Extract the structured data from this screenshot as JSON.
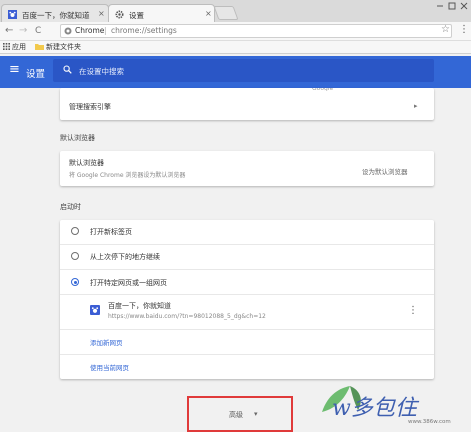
{
  "tabs": [
    {
      "title": "百度一下，你就知道",
      "close": "×"
    },
    {
      "title": "设置",
      "close": "×"
    }
  ],
  "toolbar": {
    "back": "←",
    "forward": "→",
    "reload": "C",
    "site_name": "Chrome",
    "separator": "|",
    "url": "chrome://settings",
    "star": "☆",
    "menu": "⋮"
  },
  "bookmarks": {
    "apps_label": "应用",
    "folder_label": "新建文件夹"
  },
  "header": {
    "menu_icon": "≡",
    "title": "设置",
    "search_placeholder": "在设置中搜索"
  },
  "search_engine": {
    "manage_label": "管理搜索引擎",
    "arrow": "▸",
    "partial_top": "Google"
  },
  "default_browser": {
    "section_title": "默认浏览器",
    "row_title": "默认浏览器",
    "row_sub": "将 Google Chrome 浏览器设为默认浏览器",
    "row_action": "设为默认浏览器"
  },
  "startup": {
    "section_title": "启动时",
    "options": [
      {
        "label": "打开新标签页",
        "selected": false
      },
      {
        "label": "从上次停下的地方继续",
        "selected": false
      },
      {
        "label": "打开特定网页或一组网页",
        "selected": true
      }
    ],
    "page": {
      "title": "百度一下，你就知道",
      "url": "https://www.baidu.com/?tn=98012088_5_dg&ch=12",
      "more": "⋮"
    },
    "add_page_link": "添加新网页",
    "use_current_link": "使用当前网页"
  },
  "advanced": {
    "label": "高级",
    "arrow": "▾"
  },
  "watermark": {
    "text": "w多包住",
    "sub": "www.386w.com"
  },
  "colors": {
    "header_blue": "#3367d6",
    "search_blue": "#2a56c6",
    "highlight_red": "#e03a3a",
    "link_blue": "#3367d6"
  }
}
